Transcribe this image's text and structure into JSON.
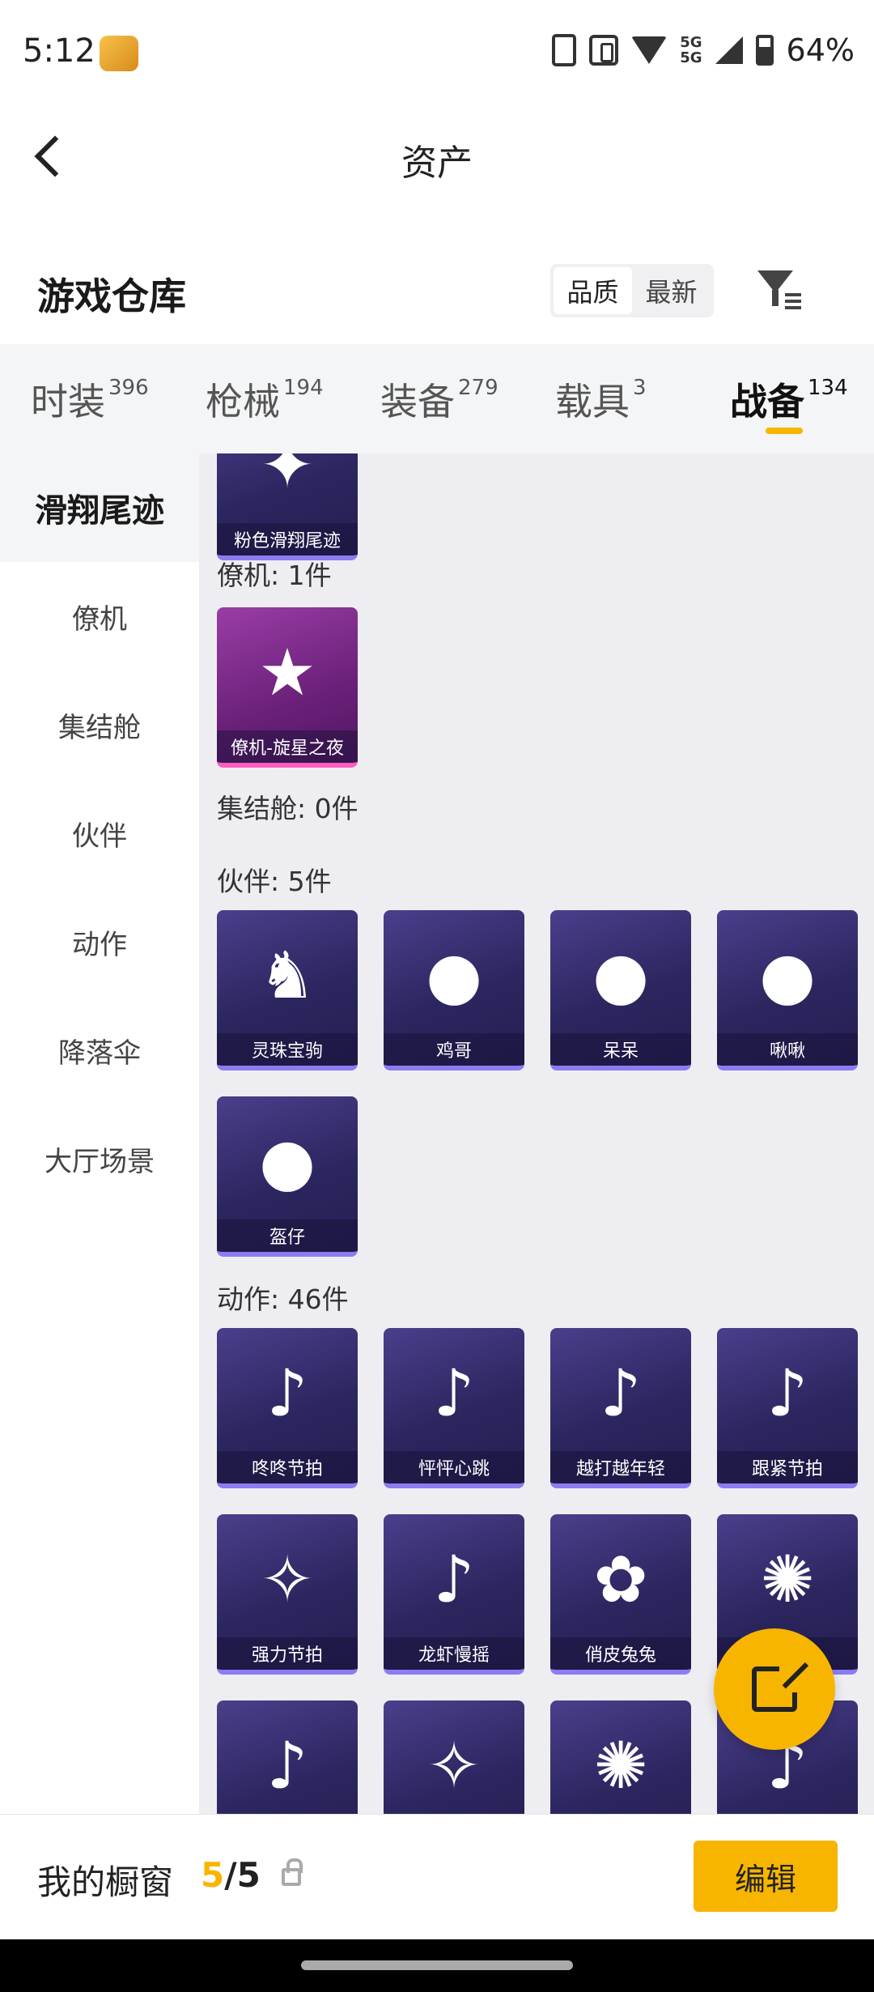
{
  "status_bar": {
    "time": "5:12",
    "app_icon_text": "和平营地",
    "network": "5G",
    "battery": "64%"
  },
  "header": {
    "title": "资产"
  },
  "warehouse": {
    "title": "游戏仓库",
    "sort_options": [
      "品质",
      "最新"
    ],
    "active_sort": "品质"
  },
  "tabs": [
    {
      "label": "时装",
      "count": "396"
    },
    {
      "label": "枪械",
      "count": "194"
    },
    {
      "label": "装备",
      "count": "279"
    },
    {
      "label": "载具",
      "count": "3"
    },
    {
      "label": "战备",
      "count": "134"
    }
  ],
  "active_tab": "战备",
  "categories": [
    "滑翔尾迹",
    "僚机",
    "集结舱",
    "伙伴",
    "动作",
    "降落伞",
    "大厅场景"
  ],
  "active_category": "滑翔尾迹",
  "sections": {
    "glide": {
      "items": [
        "粉色滑翔尾迹"
      ]
    },
    "wingman": {
      "label": "僚机: 1件",
      "items": [
        "僚机-旋星之夜"
      ]
    },
    "pod": {
      "label": "集结舱: 0件"
    },
    "partner": {
      "label": "伙伴: 5件",
      "items": [
        "灵珠宝驹",
        "鸡哥",
        "呆呆",
        "啾啾",
        "盔仔"
      ]
    },
    "action": {
      "label": "动作: 46件",
      "items": [
        "咚咚节拍",
        "怦怦心跳",
        "越打越年轻",
        "跟紧节拍",
        "强力节拍",
        "龙虾慢摇",
        "俏皮兔兔",
        "",
        "",
        "",
        "",
        ""
      ]
    }
  },
  "bottom_bar": {
    "label": "我的橱窗",
    "current": "5",
    "total": "/5",
    "edit_label": "编辑"
  },
  "colors": {
    "accent": "#f7b500",
    "card_purple": "#2c2660",
    "card_pink": "#6a2079"
  }
}
